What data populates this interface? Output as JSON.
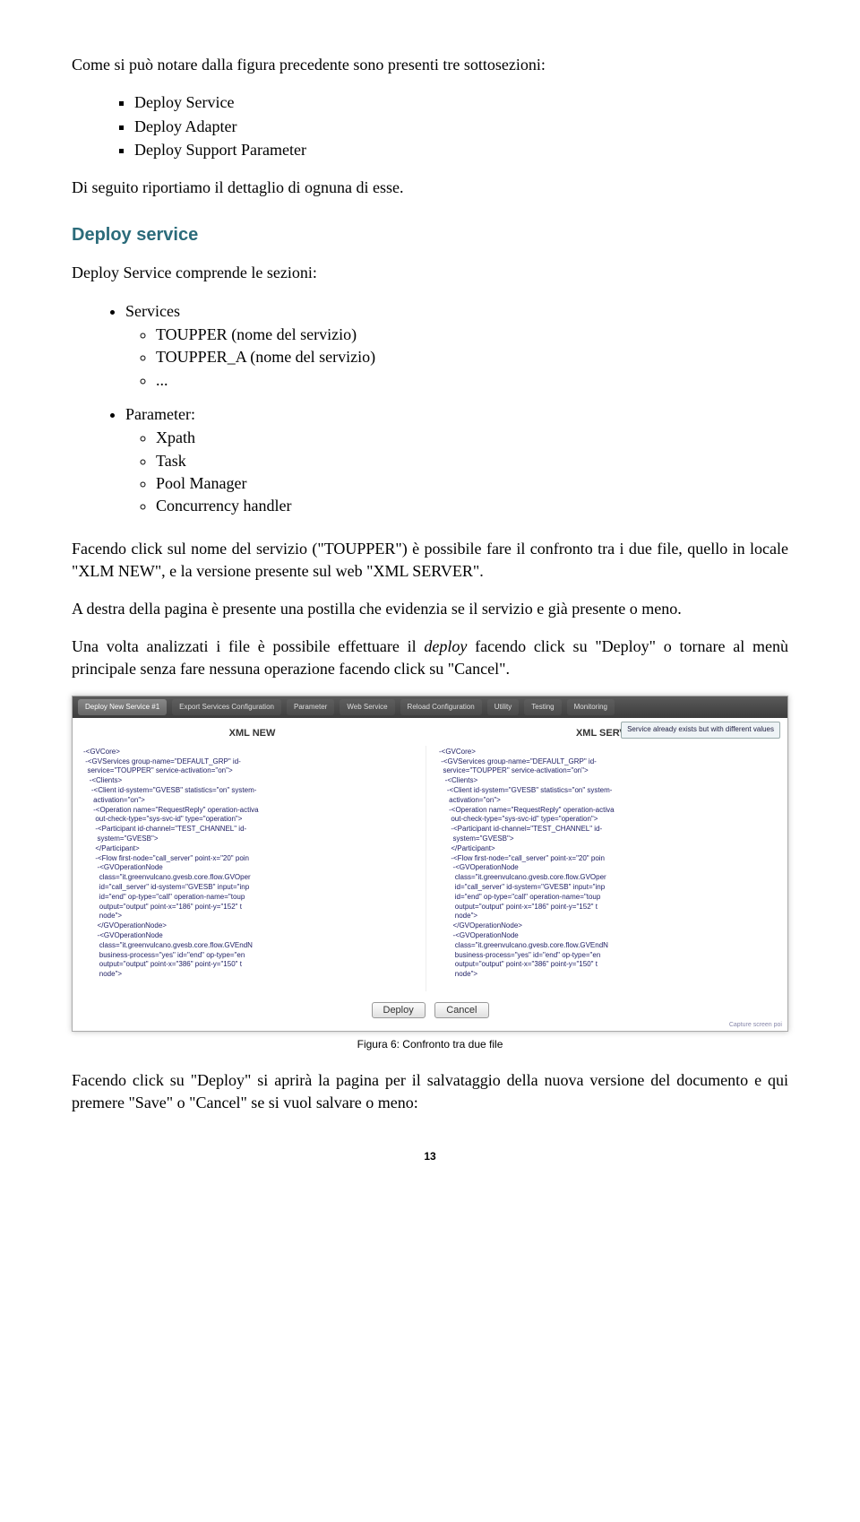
{
  "intro": {
    "p1": "Come si può notare dalla figura precedente sono presenti tre sottosezioni:",
    "list": [
      "Deploy Service",
      "Deploy Adapter",
      "Deploy Support Parameter"
    ],
    "p2": "Di seguito riportiamo il dettaglio di ognuna di esse."
  },
  "section": {
    "title": "Deploy service",
    "lead": "Deploy Service comprende le sezioni:",
    "services": {
      "label": "Services",
      "items": [
        "TOUPPER (nome del servizio)",
        "TOUPPER_A (nome del servizio)",
        "..."
      ]
    },
    "parameter": {
      "label": "Parameter:",
      "items": [
        "Xpath",
        "Task",
        "Pool Manager",
        "Concurrency handler"
      ]
    }
  },
  "body": {
    "p1": "Facendo click sul nome del servizio (\"TOUPPER\") è possibile fare il confronto tra i due file, quello in locale \"XLM NEW\", e la versione presente sul web \"XML SERVER\".",
    "p2": "A destra della pagina è presente una postilla che evidenzia se il servizio e già presente o meno.",
    "p3_a": "Una volta analizzati i file è possibile effettuare il ",
    "p3_em": "deploy",
    "p3_b": " facendo click su \"Deploy\" o tornare al menù principale senza fare nessuna operazione facendo click su \"Cancel\"."
  },
  "screenshot": {
    "tabs": [
      "Deploy New Service #1",
      "Export Services Configuration",
      "Parameter",
      "Web Service",
      "Reload Configuration",
      "Utility",
      "Testing",
      "Monitoring"
    ],
    "badge": "Service already exists but with different values",
    "left": {
      "title": "XML NEW",
      "xml": "-<GVCore>\n -<GVServices group-name=\"DEFAULT_GRP\" id-\n  service=\"TOUPPER\" service-activation=\"on\">\n   -<Clients>\n    -<Client id-system=\"GVESB\" statistics=\"on\" system-\n     activation=\"on\">\n     -<Operation name=\"RequestReply\" operation-activa\n      out-check-type=\"sys-svc-id\" type=\"operation\">\n      -<Participant id-channel=\"TEST_CHANNEL\" id-\n       system=\"GVESB\">\n      </Participant>\n      -<Flow first-node=\"call_server\" point-x=\"20\" poin\n       -<GVOperationNode\n        class=\"it.greenvulcano.gvesb.core.flow.GVOper\n        id=\"call_server\" id-system=\"GVESB\" input=\"inp\n        id=\"end\" op-type=\"call\" operation-name=\"toup\n        output=\"output\" point-x=\"186\" point-y=\"152\" t\n        node\">\n       </GVOperationNode>\n       -<GVOperationNode\n        class=\"it.greenvulcano.gvesb.core.flow.GVEndN\n        business-process=\"yes\" id=\"end\" op-type=\"en\n        output=\"output\" point-x=\"386\" point-y=\"150\" t\n        node\">"
    },
    "right": {
      "title": "XML SERVER",
      "xml": "-<GVCore>\n -<GVServices group-name=\"DEFAULT_GRP\" id-\n  service=\"TOUPPER\" service-activation=\"on\">\n   -<Clients>\n    -<Client id-system=\"GVESB\" statistics=\"on\" system-\n     activation=\"on\">\n     -<Operation name=\"RequestReply\" operation-activa\n      out-check-type=\"sys-svc-id\" type=\"operation\">\n      -<Participant id-channel=\"TEST_CHANNEL\" id-\n       system=\"GVESB\">\n      </Participant>\n      -<Flow first-node=\"call_server\" point-x=\"20\" poin\n       -<GVOperationNode\n        class=\"it.greenvulcano.gvesb.core.flow.GVOper\n        id=\"call_server\" id-system=\"GVESB\" input=\"inp\n        id=\"end\" op-type=\"call\" operation-name=\"toup\n        output=\"output\" point-x=\"186\" point-y=\"152\" t\n        node\">\n       </GVOperationNode>\n       -<GVOperationNode\n        class=\"it.greenvulcano.gvesb.core.flow.GVEndN\n        business-process=\"yes\" id=\"end\" op-type=\"en\n        output=\"output\" point-x=\"386\" point-y=\"150\" t\n        node\">"
    },
    "buttons": {
      "deploy": "Deploy",
      "cancel": "Cancel"
    },
    "corner": "Capture screen poi"
  },
  "caption": "Figura 6: Confronto tra due file",
  "closing": "Facendo click su \"Deploy\" si aprirà la pagina per il salvataggio della nuova versione del documento e qui premere \"Save\" o \"Cancel\" se si vuol salvare o  meno:",
  "pagenum": "13"
}
